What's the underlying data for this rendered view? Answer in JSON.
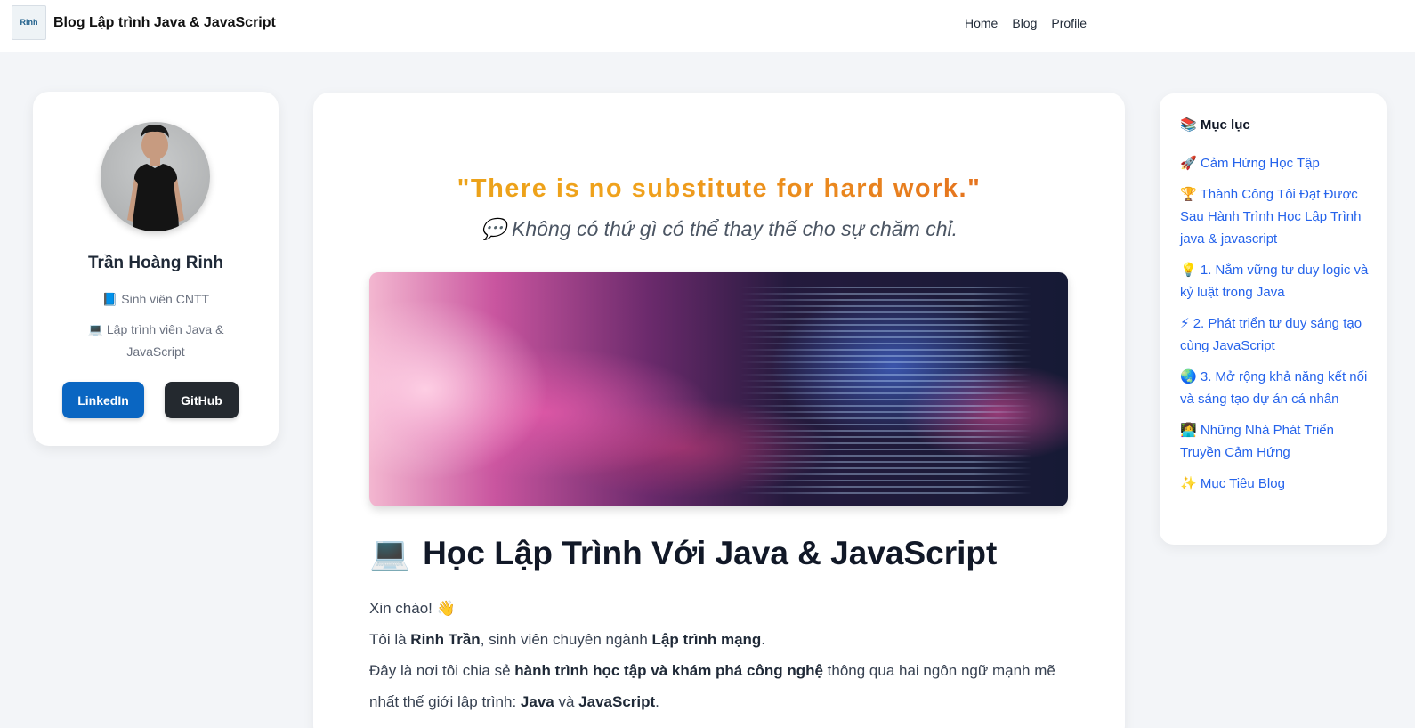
{
  "header": {
    "logo_text": "Rinh",
    "brand": "Blog Lập trình Java & JavaScript",
    "nav": [
      "Home",
      "Blog",
      "Profile"
    ]
  },
  "profile": {
    "name": "Trần Hoàng Rinh",
    "role1_icon": "📘",
    "role1": "Sinh viên CNTT",
    "role2_icon": "💻",
    "role2": "Lập trình viên Java & JavaScript",
    "linkedin": "LinkedIn",
    "github": "GitHub",
    "linkedin_color": "#0a66c2",
    "github_color": "#24292f"
  },
  "article": {
    "quote": "\"There is no substitute for hard work.\"",
    "quote_vi_icon": "💬",
    "quote_vi": "Không có thứ gì có thể thay thế cho sự chăm chỉ.",
    "title_icon": "💻",
    "title": "Học Lập Trình Với Java & JavaScript",
    "greeting": "Xin chào! 👋",
    "p1_a": "Tôi là ",
    "p1_b": "Rinh Trần",
    "p1_c": ", sinh viên chuyên ngành ",
    "p1_d": "Lập trình mạng",
    "p1_e": ".",
    "p2_a": "Đây là nơi tôi chia sẻ ",
    "p2_b": "hành trình học tập và khám phá công nghệ",
    "p2_c": " thông qua hai ngôn ngữ mạnh mẽ nhất thế giới lập trình: ",
    "p2_d": "Java",
    "p2_e": " và ",
    "p2_f": "JavaScript",
    "p2_g": "."
  },
  "toc": {
    "title_icon": "📚",
    "title": "Mục lục",
    "items": [
      {
        "icon": "🚀",
        "label": "Cảm Hứng Học Tập"
      },
      {
        "icon": "🏆",
        "label": "Thành Công Tôi Đạt Được Sau Hành Trình Học Lập Trình java & javascript"
      },
      {
        "icon": "💡",
        "label": "1. Nắm vững tư duy logic và kỷ luật trong Java"
      },
      {
        "icon": "⚡",
        "label": "2. Phát triển tư duy sáng tạo cùng JavaScript"
      },
      {
        "icon": "🌏",
        "label": "3. Mở rộng khả năng kết nối và sáng tạo dự án cá nhân"
      },
      {
        "icon": "👩‍💻",
        "label": "Những Nhà Phát Triển Truyền Cảm Hứng"
      },
      {
        "icon": "✨",
        "label": "Mục Tiêu Blog"
      }
    ]
  }
}
